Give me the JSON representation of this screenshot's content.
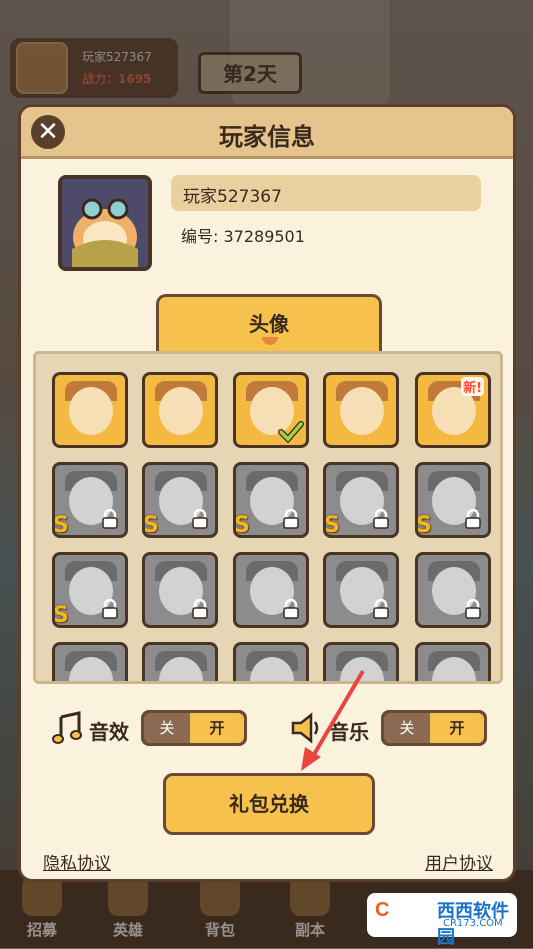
{
  "hud": {
    "player_name": "玩家527367",
    "power_label": "战力：",
    "power_value": "1695",
    "day_label": "第2天"
  },
  "dialog": {
    "title": "玩家信息",
    "close_icon": "close-icon",
    "player_name": "玩家527367",
    "player_id": "编号: 37289501",
    "tab_label": "头像",
    "avatar_grid": {
      "rows": [
        [
          {
            "state": "unlocked"
          },
          {
            "state": "unlocked"
          },
          {
            "state": "unlocked",
            "selected": true
          },
          {
            "state": "unlocked"
          },
          {
            "state": "unlocked",
            "badge": "新!"
          }
        ],
        [
          {
            "state": "locked",
            "s_badge": "S"
          },
          {
            "state": "locked",
            "s_badge": "S"
          },
          {
            "state": "locked",
            "s_badge": "S"
          },
          {
            "state": "locked",
            "s_badge": "S"
          },
          {
            "state": "locked",
            "s_badge": "S"
          }
        ],
        [
          {
            "state": "locked",
            "s_badge": "S"
          },
          {
            "state": "locked"
          },
          {
            "state": "locked"
          },
          {
            "state": "locked"
          },
          {
            "state": "locked"
          }
        ],
        [
          {
            "state": "locked"
          },
          {
            "state": "locked"
          },
          {
            "state": "locked"
          },
          {
            "state": "locked"
          },
          {
            "state": "locked"
          }
        ]
      ]
    },
    "sound_effect": {
      "label": "音效",
      "off": "关",
      "on": "开",
      "value": "开"
    },
    "music": {
      "label": "音乐",
      "off": "关",
      "on": "开",
      "value": "开"
    },
    "gift_button": "礼包兑换",
    "privacy_link": "隐私协议",
    "user_link": "用户协议"
  },
  "bottom_nav": [
    {
      "label": "招募"
    },
    {
      "label": "英雄"
    },
    {
      "label": "背包"
    },
    {
      "label": "副本"
    }
  ],
  "watermark": {
    "logo": "C",
    "name": "西西软件园",
    "url": "CR173.COM"
  },
  "colors": {
    "accent": "#f6c24d",
    "brown": "#6a4a33",
    "panel": "#fbf2de",
    "arrow": "#e8463c"
  }
}
